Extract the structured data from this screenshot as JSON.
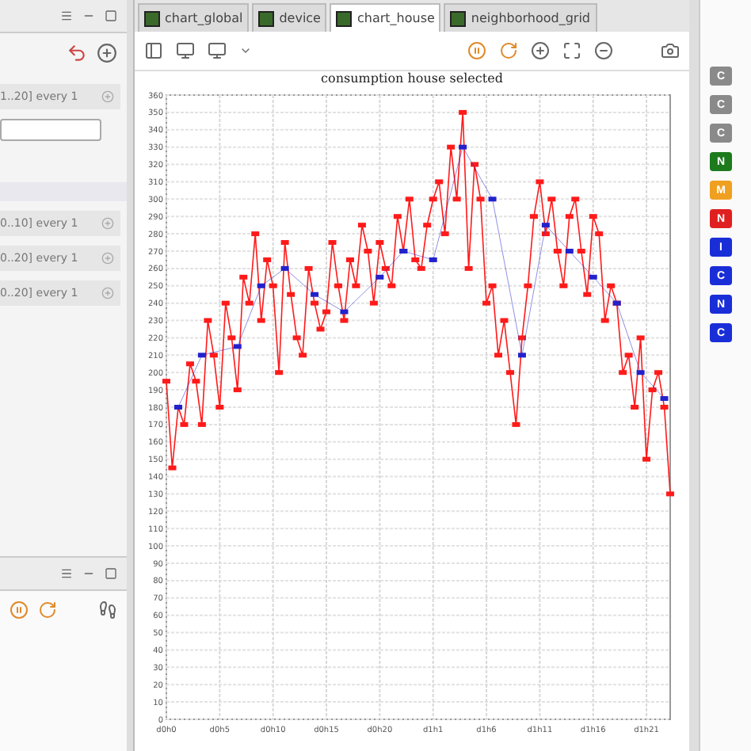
{
  "left_panel": {
    "rows": [
      {
        "kind": "param",
        "text": "1..20] every 1"
      },
      {
        "kind": "field"
      },
      {
        "kind": "header"
      },
      {
        "kind": "param",
        "text": "0..10] every 1"
      },
      {
        "kind": "param",
        "text": "0..20] every 1"
      },
      {
        "kind": "param",
        "text": "0..20] every 1"
      }
    ]
  },
  "tabs": [
    {
      "label": "chart_global",
      "selected": false
    },
    {
      "label": "device",
      "selected": false
    },
    {
      "label": "chart_house",
      "selected": true
    },
    {
      "label": "neighborhood_grid",
      "selected": false
    }
  ],
  "chart": {
    "chart_data": {
      "type": "line",
      "title": "consumption house selected",
      "ylim": [
        0,
        360
      ],
      "grid": true,
      "categories": [
        "d0h0",
        null,
        null,
        null,
        null,
        null,
        null,
        null,
        null,
        "d0h5",
        null,
        null,
        null,
        null,
        null,
        null,
        null,
        null,
        "d0h10",
        null,
        null,
        null,
        null,
        null,
        null,
        null,
        null,
        "d0h15",
        null,
        null,
        null,
        null,
        null,
        null,
        null,
        null,
        "d0h20",
        null,
        null,
        null,
        null,
        null,
        null,
        null,
        null,
        "d1h1",
        null,
        null,
        null,
        null,
        null,
        null,
        null,
        null,
        "d1h6",
        null,
        null,
        null,
        null,
        null,
        null,
        null,
        null,
        "d1h11",
        null,
        null,
        null,
        null,
        null,
        null,
        null,
        null,
        "d1h16",
        null,
        null,
        null,
        null,
        null,
        null,
        null,
        null,
        "d1h21",
        null,
        null,
        null,
        null
      ],
      "yticks": [
        0,
        10,
        20,
        30,
        40,
        50,
        60,
        70,
        80,
        90,
        100,
        110,
        120,
        130,
        140,
        150,
        160,
        170,
        180,
        190,
        200,
        210,
        220,
        230,
        240,
        250,
        260,
        270,
        280,
        290,
        300,
        310,
        320,
        330,
        340,
        350,
        360
      ],
      "series": [
        {
          "color": "#ff1a1a",
          "marker": "square",
          "values": [
            195,
            145,
            180,
            170,
            205,
            195,
            170,
            230,
            210,
            180,
            240,
            220,
            190,
            255,
            240,
            280,
            230,
            265,
            250,
            200,
            275,
            245,
            220,
            210,
            260,
            240,
            225,
            235,
            275,
            250,
            230,
            265,
            250,
            285,
            270,
            240,
            275,
            260,
            250,
            290,
            270,
            300,
            265,
            260,
            285,
            300,
            310,
            280,
            330,
            300,
            350,
            260,
            320,
            300,
            240,
            250,
            210,
            230,
            200,
            170,
            220,
            250,
            290,
            310,
            280,
            300,
            270,
            250,
            290,
            300,
            270,
            245,
            290,
            280,
            230,
            250,
            240,
            200,
            210,
            180,
            220,
            150,
            190,
            200,
            180,
            130
          ]
        },
        {
          "color": "#2222cc",
          "marker": "square",
          "values": [
            null,
            null,
            180,
            null,
            null,
            null,
            210,
            null,
            null,
            null,
            null,
            null,
            215,
            null,
            null,
            null,
            250,
            null,
            null,
            null,
            260,
            null,
            null,
            null,
            null,
            245,
            null,
            null,
            null,
            null,
            235,
            null,
            null,
            null,
            null,
            null,
            255,
            null,
            null,
            null,
            270,
            null,
            null,
            null,
            null,
            265,
            null,
            null,
            null,
            null,
            330,
            null,
            null,
            null,
            null,
            300,
            null,
            null,
            null,
            null,
            210,
            null,
            null,
            null,
            285,
            null,
            null,
            null,
            270,
            null,
            null,
            null,
            255,
            null,
            null,
            null,
            240,
            null,
            null,
            null,
            200,
            null,
            null,
            null,
            185,
            null
          ]
        }
      ]
    }
  },
  "right_buttons": [
    {
      "text": "C",
      "color": "#8a8a8a"
    },
    {
      "text": "C",
      "color": "#8a8a8a"
    },
    {
      "text": "C",
      "color": "#8a8a8a"
    },
    {
      "text": "N",
      "color": "#1d7a1d"
    },
    {
      "text": "M",
      "color": "#f0a020"
    },
    {
      "text": "N",
      "color": "#e02020"
    },
    {
      "text": "I",
      "color": "#1a2ed8"
    },
    {
      "text": "C",
      "color": "#1a2ed8"
    },
    {
      "text": "N",
      "color": "#1a2ed8"
    },
    {
      "text": "C",
      "color": "#1a2ed8"
    }
  ]
}
